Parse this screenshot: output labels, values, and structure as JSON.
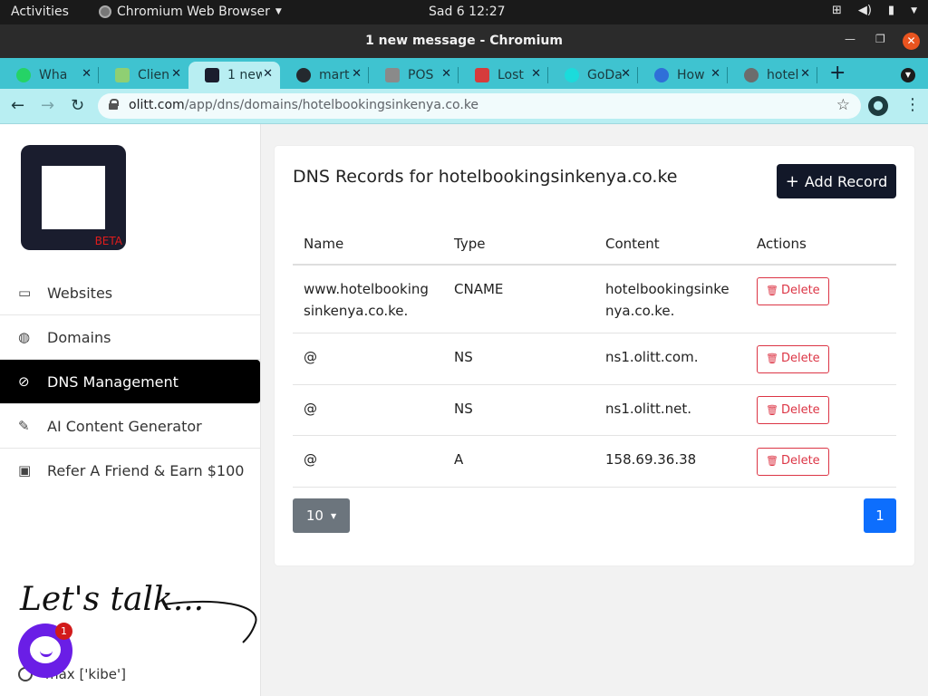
{
  "os": {
    "activities": "Activities",
    "app_menu": "Chromium Web Browser",
    "clock": "Sad 6  12:27"
  },
  "window": {
    "title": "1 new message - Chromium"
  },
  "tabs": [
    {
      "label": "Wha",
      "icon": "whatsapp-icon",
      "color": "#25d366"
    },
    {
      "label": "Clien",
      "icon": "client-icon",
      "color": "#8fcf73"
    },
    {
      "label": "1 new",
      "icon": "olitt-icon",
      "color": "#1a1d2e"
    },
    {
      "label": "mart",
      "icon": "github-icon",
      "color": "#24292e"
    },
    {
      "label": "POS",
      "icon": "pos-icon",
      "color": "#8a8a8a"
    },
    {
      "label": "Lost",
      "icon": "lost-icon",
      "color": "#d63c3c"
    },
    {
      "label": "GoDa",
      "icon": "godaddy-icon",
      "color": "#1bdbdb"
    },
    {
      "label": "How",
      "icon": "how-icon",
      "color": "#2f6fd8"
    },
    {
      "label": "hotel",
      "icon": "globe-icon",
      "color": "#6c6c6c"
    }
  ],
  "address_bar": {
    "host": "olitt.com",
    "path": "/app/dns/domains/hotelbookingsinkenya.co.ke"
  },
  "sidebar": {
    "beta_label": "BETA",
    "items": [
      {
        "label": "Websites",
        "icon": "websites-icon",
        "glyph": "▭"
      },
      {
        "label": "Domains",
        "icon": "globe-icon",
        "glyph": "◍"
      },
      {
        "label": "DNS Management",
        "icon": "compass-icon",
        "glyph": "⊘"
      },
      {
        "label": "AI Content Generator",
        "icon": "pencil-icon",
        "glyph": "✎"
      },
      {
        "label": "Refer A Friend & Earn $100",
        "icon": "money-icon",
        "glyph": "▣"
      }
    ],
    "chat_badge": "1",
    "user_name": "max ['kibe']"
  },
  "main": {
    "title": "DNS Records for hotelbookingsinkenya.co.ke",
    "add_record_label": "Add Record",
    "columns": [
      "Name",
      "Type",
      "Content",
      "Actions"
    ],
    "rows": [
      {
        "name": "www.hotelbookingsinkenya.co.ke.",
        "type": "CNAME",
        "content": "hotelbookingsinkenya.co.ke.",
        "action": "Delete"
      },
      {
        "name": "@",
        "type": "NS",
        "content": "ns1.olitt.com.",
        "action": "Delete"
      },
      {
        "name": "@",
        "type": "NS",
        "content": "ns1.olitt.net.",
        "action": "Delete"
      },
      {
        "name": "@",
        "type": "A",
        "content": "158.69.36.38",
        "action": "Delete"
      }
    ],
    "page_size": "10",
    "current_page": "1"
  }
}
